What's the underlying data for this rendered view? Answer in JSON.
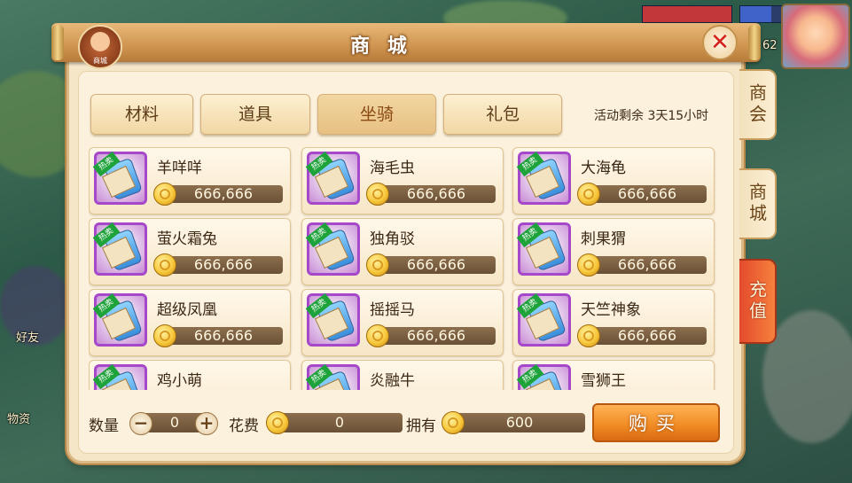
{
  "header": {
    "title": "商 城",
    "emblem_label": "商城"
  },
  "side_tabs": [
    {
      "label": "商会"
    },
    {
      "label": "商城"
    },
    {
      "label": "充值"
    }
  ],
  "categories": [
    {
      "label": "材料"
    },
    {
      "label": "道具"
    },
    {
      "label": "坐骑"
    },
    {
      "label": "礼包"
    }
  ],
  "active_category": "坐骑",
  "activity_remaining": "活动剩余 3天15小时",
  "items": [
    {
      "name": "羊咩咩",
      "price": "666,666",
      "badge": "热卖"
    },
    {
      "name": "海毛虫",
      "price": "666,666",
      "badge": "热卖"
    },
    {
      "name": "大海龟",
      "price": "666,666",
      "badge": "热卖"
    },
    {
      "name": "萤火霜兔",
      "price": "666,666",
      "badge": "热卖"
    },
    {
      "name": "独角驳",
      "price": "666,666",
      "badge": "热卖"
    },
    {
      "name": "刺果猬",
      "price": "666,666",
      "badge": "热卖"
    },
    {
      "name": "超级凤凰",
      "price": "666,666",
      "badge": "热卖"
    },
    {
      "name": "摇摇马",
      "price": "666,666",
      "badge": "热卖"
    },
    {
      "name": "天竺神象",
      "price": "666,666",
      "badge": "热卖"
    },
    {
      "name": "鸡小萌",
      "price": "",
      "badge": "热卖"
    },
    {
      "name": "炎融牛",
      "price": "",
      "badge": "热卖"
    },
    {
      "name": "雪狮王",
      "price": "",
      "badge": "热卖"
    }
  ],
  "footer": {
    "quantity_label": "数量",
    "quantity_value": "0",
    "minus": "−",
    "plus": "+",
    "cost_label": "花费",
    "cost_value": "0",
    "own_label": "拥有",
    "own_value": "600",
    "buy_label": "购买"
  },
  "background": {
    "number": "62",
    "texts": [
      "好友",
      "物资"
    ]
  },
  "icons": {
    "close": "close-x-icon",
    "coin": "gold-coin-icon",
    "item": "mount-scroll-icon"
  },
  "colors": {
    "panel": "#f5e6c8",
    "recharge_tab": "#e44a2d",
    "buy_button": "#f08a23",
    "badge": "#1ea33a",
    "close": "#d4231c"
  }
}
